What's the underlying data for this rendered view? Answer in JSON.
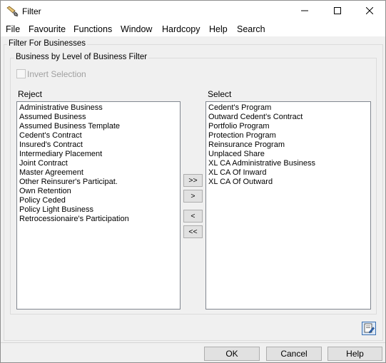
{
  "window": {
    "title": "Filter",
    "minimize_icon": "minimize-icon",
    "maximize_icon": "maximize-icon",
    "close_icon": "close-icon"
  },
  "menu": [
    "File",
    "Favourite",
    "Functions",
    "Window",
    "Hardcopy",
    "Help",
    "Search"
  ],
  "outer_group": {
    "caption": "Filter For Businesses"
  },
  "inner_group": {
    "caption": "Business by Level of Business Filter"
  },
  "invert_selection": {
    "label": "Invert Selection",
    "checked": false,
    "enabled": false
  },
  "reject": {
    "label": "Reject",
    "items": [
      "Administrative Business",
      "Assumed Business",
      "Assumed Business Template",
      "Cedent's Contract",
      "Insured's Contract",
      "Intermediary Placement",
      "Joint Contract",
      "Master Agreement",
      "Other Reinsurer's Participat.",
      "Own Retention",
      "Policy Ceded",
      "Policy Light Business",
      "Retrocessionaire's Participation"
    ]
  },
  "select": {
    "label": "Select",
    "items": [
      "Cedent's Program",
      "Outward Cedent's Contract",
      "Portfolio Program",
      "Protection Program",
      "Reinsurance Program",
      "Unplaced Share",
      "XL CA Administrative Business",
      "XL CA Of Inward",
      "XL CA Of Outward"
    ]
  },
  "transfer_buttons": {
    "move_all_right": ">>",
    "move_right": ">",
    "move_left": "<",
    "move_all_left": "<<"
  },
  "footer": {
    "ok": "OK",
    "cancel": "Cancel",
    "help": "Help",
    "corner_icon": "edit-filter-icon"
  },
  "colors": {
    "window_bg": "#f0f0f0",
    "titlebar_bg": "#ffffff",
    "button_bg": "#e1e1e1",
    "button_border": "#adadad",
    "list_border": "#828790"
  }
}
